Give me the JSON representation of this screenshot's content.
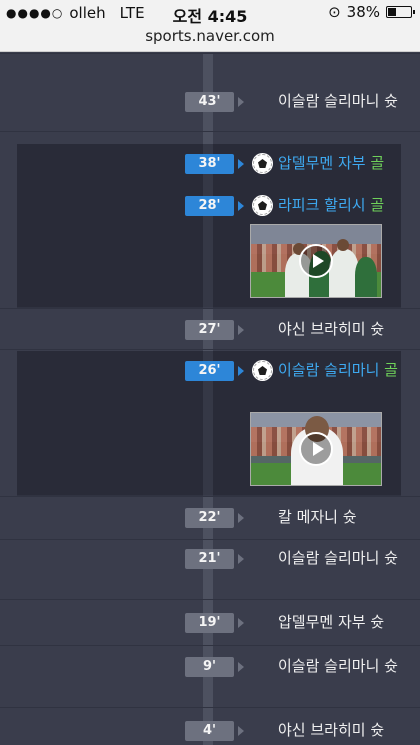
{
  "status": {
    "signal_dots": "●●●●○",
    "carrier": "olleh",
    "network": "LTE",
    "time": "오전 4:45",
    "rotation_lock_icon": "rotation-lock-icon",
    "battery_percent": "38%",
    "battery_level": 0.38
  },
  "url": "sports.naver.com",
  "colors": {
    "background": "#3a3d4c",
    "goal_panel": "#292b38",
    "minute_badge": "#6d717f",
    "minute_badge_highlight": "#2d86d8",
    "goal_text": "#3ea9f0",
    "goal_word": "#6fd15a"
  },
  "events": [
    {
      "minute": "43'",
      "text": "이슬람 슬리마니 슛"
    },
    {
      "minute": "38'",
      "player": "압델무멘 자부",
      "goal_word": "골",
      "icon": "soccer-ball-icon"
    },
    {
      "minute": "28'",
      "player": "라피크 할리시",
      "goal_word": "골",
      "icon": "soccer-ball-icon",
      "video": "video-thumbnail"
    },
    {
      "minute": "27'",
      "text": "야신 브라히미 슛"
    },
    {
      "minute": "26'",
      "player": "이슬람 슬리마니",
      "goal_word": "골",
      "icon": "soccer-ball-icon",
      "video": "video-thumbnail"
    },
    {
      "minute": "22'",
      "text": "칼 메자니 슛"
    },
    {
      "minute": "21'",
      "text": "이슬람 슬리마니 슛"
    },
    {
      "minute": "19'",
      "text": "압델무멘 자부 슛"
    },
    {
      "minute": "9'",
      "text": "이슬람 슬리마니 슛"
    },
    {
      "minute": "4'",
      "text": "야신 브라히미 슛"
    }
  ]
}
